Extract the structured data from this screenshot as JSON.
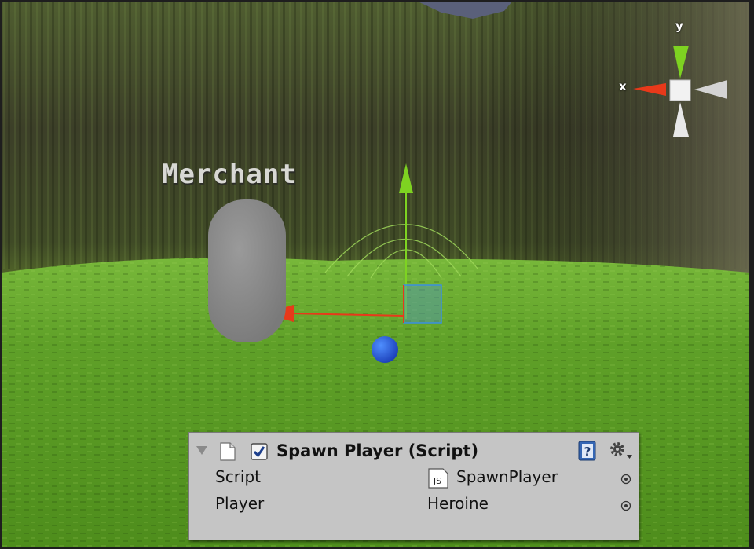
{
  "scene": {
    "merchant_label": "Merchant",
    "orientation_gizmo": {
      "x_label": "x",
      "y_label": "y"
    }
  },
  "inspector": {
    "component_title": "Spawn Player (Script)",
    "enabled": true,
    "properties": [
      {
        "label": "Script",
        "value": "SpawnPlayer",
        "icon": "js-script-icon"
      },
      {
        "label": "Player",
        "value": "Heroine"
      }
    ]
  },
  "colors": {
    "x_axis": "#e8391a",
    "y_axis": "#7ed321",
    "z_axis": "#3a8fe0",
    "panel_bg": "#c5c5c5",
    "grass": "#6aaa2a"
  }
}
